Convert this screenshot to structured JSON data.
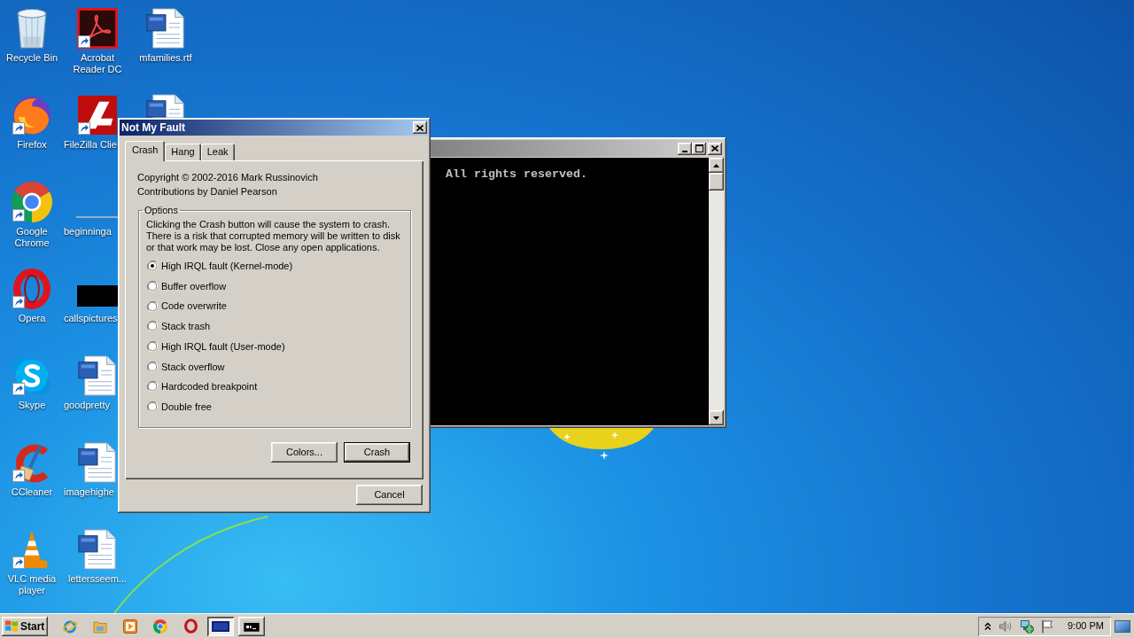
{
  "desktop_icons": [
    {
      "kind": "recycle-bin",
      "label": "Recycle Bin",
      "shortcut": false
    },
    {
      "kind": "firefox",
      "label": "Firefox",
      "shortcut": true
    },
    {
      "kind": "chrome",
      "label": "Google Chrome",
      "shortcut": true
    },
    {
      "kind": "opera",
      "label": "Opera",
      "shortcut": true
    },
    {
      "kind": "skype",
      "label": "Skype",
      "shortcut": true
    },
    {
      "kind": "ccleaner",
      "label": "CCleaner",
      "shortcut": true
    },
    {
      "kind": "vlc",
      "label": "VLC media player",
      "shortcut": true
    },
    {
      "kind": "acrobat",
      "label": "Acrobat Reader DC",
      "shortcut": true
    },
    {
      "kind": "filezilla",
      "label": "FileZilla Clie",
      "shortcut": true
    },
    {
      "kind": "thumb-line",
      "label": "beginninga",
      "shortcut": false
    },
    {
      "kind": "thumb-black",
      "label": "callspictures",
      "shortcut": false
    },
    {
      "kind": "word-doc",
      "label": "goodpretty",
      "shortcut": false
    },
    {
      "kind": "word-doc",
      "label": "imagehighe",
      "shortcut": false
    },
    {
      "kind": "word-doc",
      "label": "lettersseem...",
      "shortcut": false
    },
    {
      "kind": "word-doc",
      "label": "mfamilies.rtf",
      "shortcut": false
    },
    {
      "kind": "word-doc",
      "shortcut": false
    }
  ],
  "console": {
    "lines": [
      "All rights reserved."
    ]
  },
  "dialog": {
    "title": "Not My Fault",
    "tabs": [
      {
        "label": "Crash",
        "selected": true
      },
      {
        "label": "Hang",
        "selected": false
      },
      {
        "label": "Leak",
        "selected": false
      }
    ],
    "copyright": [
      "Copyright © 2002-2016 Mark Russinovich",
      "Contributions by Daniel Pearson"
    ],
    "options": {
      "legend": "Options",
      "description": "Clicking the Crash button will cause the system to crash. There is a risk that corrupted memory will be written to disk or that work may be lost. Close any open applications.",
      "choices": [
        {
          "label": "High IRQL fault (Kernel-mode)",
          "selected": true
        },
        {
          "label": "Buffer overflow",
          "selected": false
        },
        {
          "label": "Code overwrite",
          "selected": false
        },
        {
          "label": "Stack trash",
          "selected": false
        },
        {
          "label": "High IRQL fault (User-mode)",
          "selected": false
        },
        {
          "label": "Stack overflow",
          "selected": false
        },
        {
          "label": "Hardcoded breakpoint",
          "selected": false
        },
        {
          "label": "Double free",
          "selected": false
        }
      ]
    },
    "buttons": [
      {
        "label": "Colors...",
        "default": false
      },
      {
        "label": "Crash",
        "default": true
      }
    ],
    "cancel": "Cancel"
  },
  "taskbar": {
    "start": "Start",
    "quick_launch": [
      {
        "kind": "ie"
      },
      {
        "kind": "explorer"
      },
      {
        "kind": "media"
      },
      {
        "kind": "chrome"
      },
      {
        "kind": "opera"
      }
    ],
    "windows": [
      {
        "kind": "dialog",
        "selected": true
      },
      {
        "kind": "console",
        "selected": false
      }
    ],
    "tray": {
      "icons": [
        {
          "kind": "chevron"
        },
        {
          "kind": "speaker"
        },
        {
          "kind": "network"
        },
        {
          "kind": "flag"
        }
      ],
      "clock": "9:00 PM"
    }
  }
}
